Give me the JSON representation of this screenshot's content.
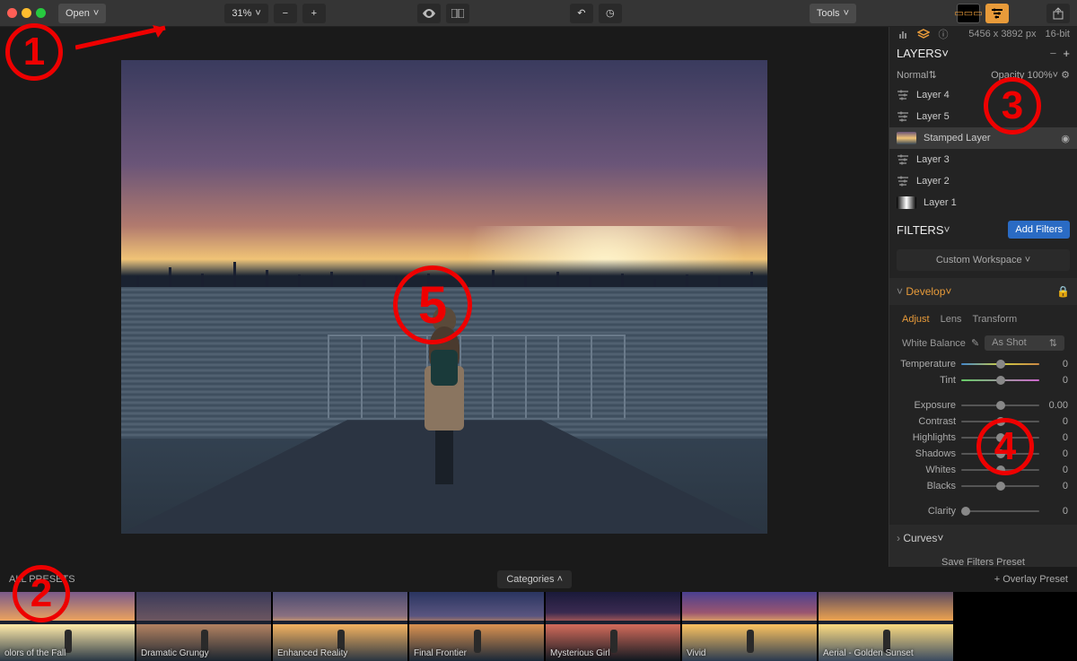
{
  "toolbar": {
    "open": "Open",
    "zoom": "31%",
    "tools": "Tools"
  },
  "imageinfo": {
    "dimensions": "5456 x 3892 px",
    "depth": "16-bit"
  },
  "layers": {
    "title": "LAYERS",
    "blend": "Normal",
    "opacity_label": "Opacity",
    "opacity_value": "100%",
    "items": [
      {
        "name": "Layer 4"
      },
      {
        "name": "Layer 5"
      },
      {
        "name": "Stamped Layer"
      },
      {
        "name": "Layer 3"
      },
      {
        "name": "Layer 2"
      },
      {
        "name": "Layer 1"
      }
    ]
  },
  "filters": {
    "title": "FILTERS",
    "add": "Add Filters",
    "workspace": "Custom Workspace",
    "develop": "Develop",
    "tabs": {
      "adjust": "Adjust",
      "lens": "Lens",
      "transform": "Transform"
    },
    "wb": {
      "label": "White Balance",
      "value": "As Shot"
    },
    "sliders": [
      {
        "label": "Temperature",
        "value": "0",
        "pos": 50,
        "cls": "temp-track"
      },
      {
        "label": "Tint",
        "value": "0",
        "pos": 50,
        "cls": "tint-track"
      },
      {
        "label": "Exposure",
        "value": "0.00",
        "pos": 50
      },
      {
        "label": "Contrast",
        "value": "0",
        "pos": 50
      },
      {
        "label": "Highlights",
        "value": "0",
        "pos": 50
      },
      {
        "label": "Shadows",
        "value": "0",
        "pos": 50
      },
      {
        "label": "Whites",
        "value": "0",
        "pos": 50
      },
      {
        "label": "Blacks",
        "value": "0",
        "pos": 50
      },
      {
        "label": "Clarity",
        "value": "0",
        "pos": 6
      }
    ],
    "curves": "Curves",
    "save_preset": "Save Filters Preset"
  },
  "presets": {
    "label": "ALL PRESETS",
    "categories": "Categories",
    "overlay": "+ Overlay Preset",
    "items": [
      {
        "name": "olors of the Fall",
        "grad": "linear-gradient(180deg,#7a5a8a 0%,#e8a060 40%,#fce8a8 48%,#2a3845 100%)"
      },
      {
        "name": "Dramatic Grungy",
        "grad": "linear-gradient(180deg,#3a3a5a 0%,#6a5560 40%,#b08060 48%,#1a2530 100%)"
      },
      {
        "name": "Enhanced Reality",
        "grad": "linear-gradient(180deg,#4a4a70 0%,#8a7080 35%,#f0b060 48%,#2a3542 100%)"
      },
      {
        "name": "Final Frontier",
        "grad": "linear-gradient(180deg,#2a3560 0%,#5a5580 35%,#d89050 48%,#1a2838 100%)"
      },
      {
        "name": "Mysterious Girl",
        "grad": "linear-gradient(180deg,#1a1a3a 0%,#3a2a50 30%,#d06a5a 48%,#101820 100%)"
      },
      {
        "name": "Vivid",
        "grad": "linear-gradient(180deg,#4a4090 0%,#9a5570 30%,#f8c060 48%,#2a3a50 100%)"
      },
      {
        "name": "Aerial - Golden Sunset",
        "grad": "linear-gradient(180deg,#5a4a60 0%,#e8a050 40%,#f8d880 48%,#3a4a60 100%)"
      }
    ]
  },
  "annotations": [
    "1",
    "2",
    "3",
    "4",
    "5"
  ]
}
